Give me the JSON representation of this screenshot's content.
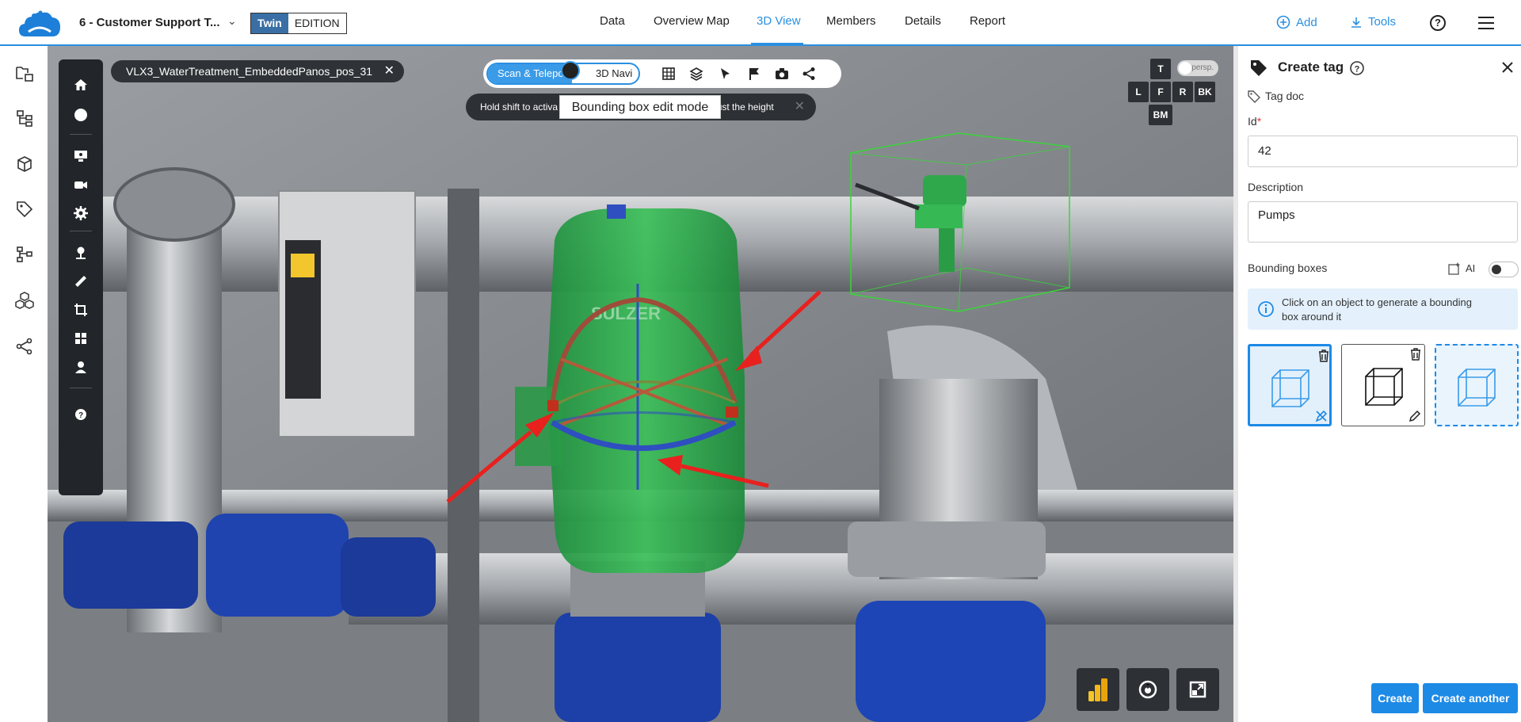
{
  "header": {
    "project_name": "6 - Customer Support T...",
    "edition_badge": "Twin",
    "edition_label": "EDITION",
    "tabs": [
      {
        "label": "Data"
      },
      {
        "label": "Overview Map"
      },
      {
        "label": "3D View"
      },
      {
        "label": "Members"
      },
      {
        "label": "Details"
      },
      {
        "label": "Report"
      }
    ],
    "active_tab": "3D View",
    "add_label": "Add",
    "tools_label": "Tools",
    "accent_color": "#2b8fe0"
  },
  "left_rail": {
    "items": [
      "folder-tree-icon",
      "hierarchy-icon",
      "cube-icon",
      "tag-icon",
      "network-icon",
      "cubes-icon",
      "share-icon"
    ]
  },
  "viewport": {
    "scan_name": "VLX3_WaterTreatment_EmbeddedPanos_pos_31",
    "mode_primary": "Scan & Teleport",
    "mode_secondary": "3D Navi",
    "hint_text": "Hold shift to activate the grab tool or to adjust the height",
    "hint_prefix": "Hold shift to activa",
    "hint_suffix": "just the height",
    "edit_mode_label": "Bounding box edit mode",
    "view_cube": {
      "top": "T",
      "left": "L",
      "front": "F",
      "right": "R",
      "back": "BK",
      "bottom": "BM"
    },
    "projection_label": "persp.",
    "tool_icons": [
      "home-icon",
      "sphere-icon",
      "monitor-icon",
      "camera-icon",
      "settings-icon",
      "pin-icon",
      "measure-icon",
      "crop-icon",
      "layers-icon",
      "person-icon",
      "help-icon"
    ],
    "bottom_buttons": [
      "powerbi-icon",
      "scan-icon",
      "fullscreen-icon"
    ]
  },
  "panel": {
    "title": "Create tag",
    "tag_doc": "Tag doc",
    "id_label": "Id",
    "required_mark": "*",
    "id_value": "42",
    "description_label": "Description",
    "description_value": "Pumps",
    "bbox_label": "Bounding boxes",
    "ai_label": "AI",
    "info_text": "Click on an object to generate a bounding box around it",
    "create_label": "Create",
    "create_another_label": "Create another"
  }
}
